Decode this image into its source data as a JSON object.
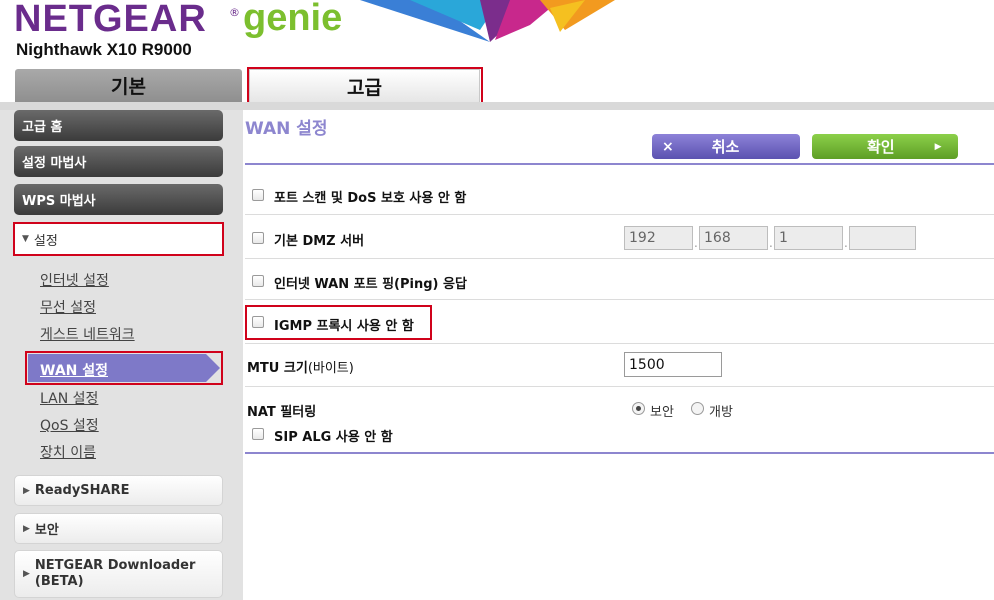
{
  "header": {
    "brand": "NETGEAR",
    "brand_reg": "®",
    "product": "genie",
    "model": "Nighthawk X10 R9000"
  },
  "tabs": {
    "basic": "기본",
    "advanced": "고급"
  },
  "sidebar": {
    "advanced_home": "고급 홈",
    "setup_wizard": "설정 마법사",
    "wps_wizard": "WPS 마법사",
    "settings": "설정",
    "sub_items": [
      "인터넷 설정",
      "무선 설정",
      "게스트 네트워크",
      "WAN 설정",
      "LAN 설정",
      "QoS 설정",
      "장치 이름"
    ],
    "readyshare": "ReadySHARE",
    "security": "보안",
    "downloader_line1": "NETGEAR Downloader",
    "downloader_line2": "(BETA)"
  },
  "main": {
    "title": "WAN 설정",
    "cancel_label": "취소",
    "cancel_icon": "×",
    "ok_label": "확인",
    "ok_icon": "▶",
    "options": {
      "disable_portscan_dos": "포트 스캔 및 DoS 보호 사용 안 함",
      "default_dmz": "기본 DMZ 서버",
      "wan_ping": "인터넷 WAN 포트 핑(Ping) 응답",
      "disable_igmp": "IGMP 프록시 사용 안 함",
      "disable_sip_alg": "SIP ALG 사용 안 함"
    },
    "dmz_ip": [
      "192",
      "168",
      "1",
      ""
    ],
    "mtu_label_bold": "MTU 크기",
    "mtu_label_rest": "(바이트)",
    "mtu_value": "1500",
    "nat_label": "NAT 필터링",
    "nat_secure": "보안",
    "nat_open": "개방",
    "nat_selected": "보안"
  },
  "colors": {
    "brand_purple": "#6a2c8c",
    "genie_green": "#7cbf2e",
    "accent_purple": "#8d86cf",
    "highlight_red": "#d0021b"
  }
}
